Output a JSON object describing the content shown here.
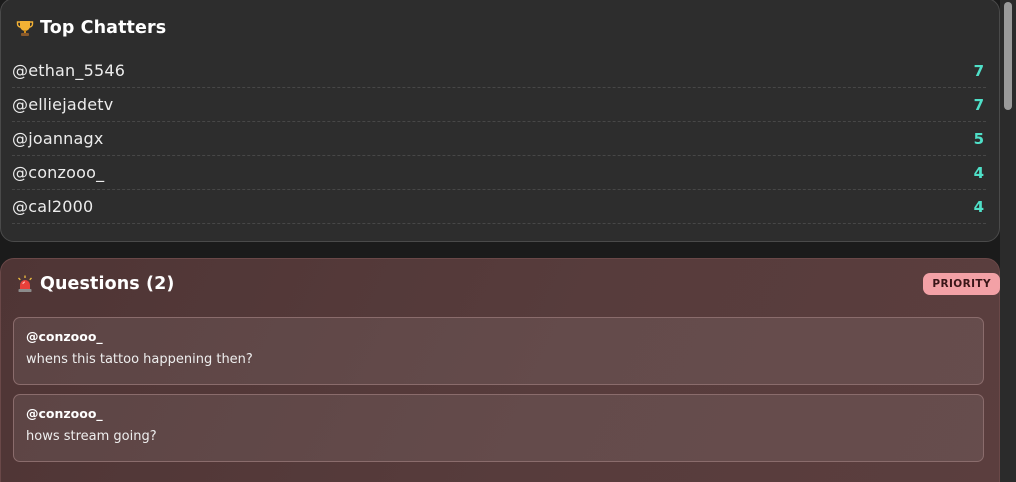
{
  "top_chatters": {
    "title": "Top Chatters",
    "icon": "trophy-icon",
    "items": [
      {
        "name": "@ethan_5546",
        "count": "7"
      },
      {
        "name": "@elliejadetv",
        "count": "7"
      },
      {
        "name": "@joannagx",
        "count": "5"
      },
      {
        "name": "@conzooo_",
        "count": "4"
      },
      {
        "name": "@cal2000",
        "count": "4"
      }
    ]
  },
  "questions": {
    "title": "Questions (2)",
    "icon": "siren-icon",
    "badge": "PRIORITY",
    "items": [
      {
        "user": "@conzooo_",
        "text": "whens this tattoo happening then?"
      },
      {
        "user": "@conzooo_",
        "text": "hows stream going?"
      }
    ]
  },
  "colors": {
    "accent_count": "#4fe0c8",
    "priority_badge": "#f3a1a6",
    "questions_bg": "#573c3c",
    "chatters_bg": "#2d2d2d"
  }
}
